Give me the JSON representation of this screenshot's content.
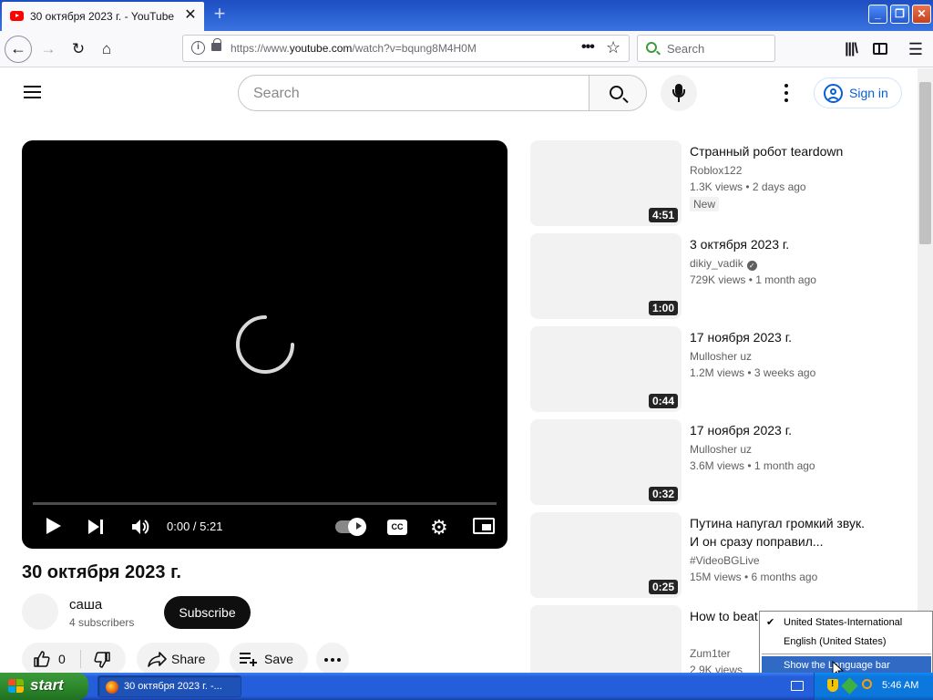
{
  "browser": {
    "tab_title": "30 октября 2023 г. - YouTube",
    "tab_close": "✕",
    "new_tab": "+",
    "url_prefix": "https://www.",
    "url_main": "youtube.com",
    "url_suffix": "/watch?v=bqung8M4H0M",
    "search_placeholder": "Search"
  },
  "masthead": {
    "search_placeholder": "Search",
    "sign_in": "Sign in"
  },
  "player": {
    "time": "0:00 / 5:21",
    "cc_label": "CC"
  },
  "video": {
    "title": "30 октября 2023 г.",
    "channel": "саша",
    "subscribers": "4 subscribers",
    "subscribe": "Subscribe",
    "likes": "0",
    "share": "Share",
    "save": "Save"
  },
  "recommendations": [
    {
      "title": "Странный робот teardown",
      "channel": "Roblox122",
      "meta": "1.3K views  • 2 days ago",
      "badge": "New",
      "duration": "4:51",
      "verified": false
    },
    {
      "title": "3 октября 2023 г.",
      "channel": "dikiy_vadik",
      "meta": "729K views  • 1 month ago",
      "duration": "1:00",
      "verified": true
    },
    {
      "title": "17 ноября 2023 г.",
      "channel": "Mullosher uz",
      "meta": "1.2M views  • 3 weeks ago",
      "duration": "0:44",
      "verified": false
    },
    {
      "title": "17 ноября 2023 г.",
      "channel": "Mullosher uz",
      "meta": "3.6M views  • 1 month ago",
      "duration": "0:32",
      "verified": false
    },
    {
      "title": "Путина напугал громкий звук. И он сразу поправил...",
      "channel": "#VideoBGLive",
      "meta": "15M views  • 6 months ago",
      "duration": "0:25",
      "verified": false
    },
    {
      "title": "How to beat ... MINUTES - ...",
      "channel": "Zum1ter",
      "meta": "2.9K views",
      "duration": "",
      "verified": false
    }
  ],
  "language_menu": {
    "items": [
      "United States-International",
      "English (United States)"
    ],
    "checked_index": 0,
    "show_bar": "Show the Language bar"
  },
  "taskbar": {
    "start": "start",
    "task_title": "30 октября 2023 г. -...",
    "clock": "5:46 AM"
  },
  "colors": {
    "yt_red": "#ff0000",
    "link_blue": "#065fd4",
    "xp_blue": "#245edb",
    "xp_green": "#2d8a2d",
    "menu_highlight": "#316ac5"
  }
}
